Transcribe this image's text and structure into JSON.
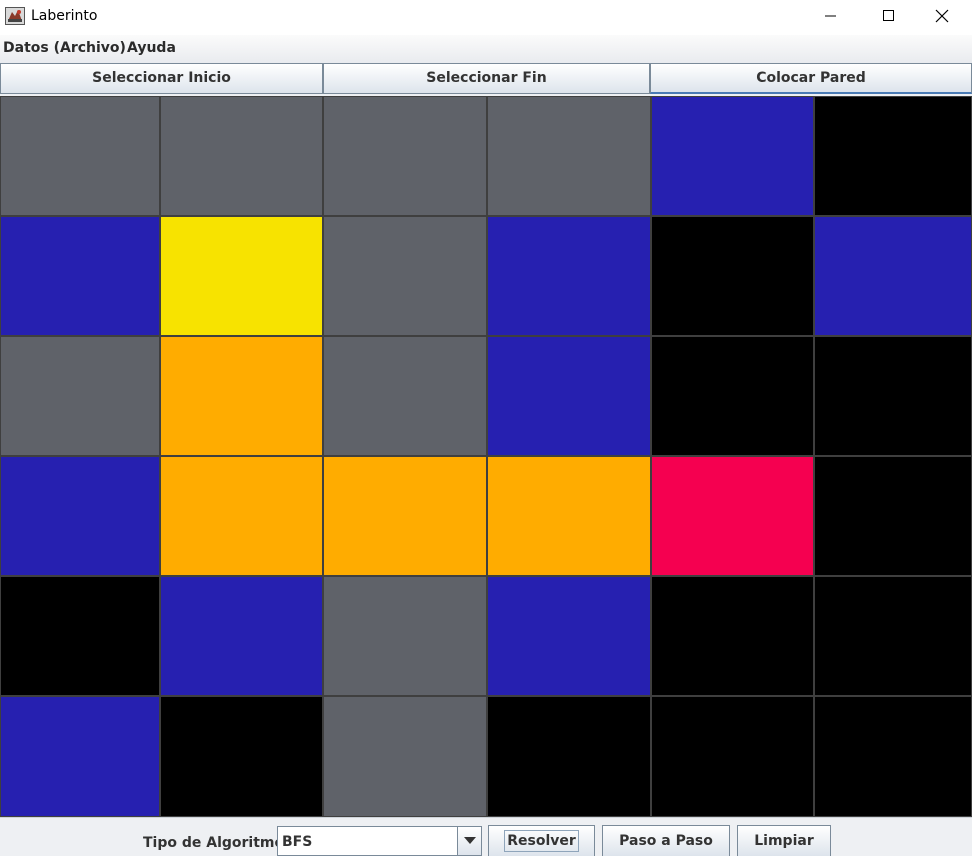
{
  "window": {
    "title": "Laberinto",
    "icons": {
      "app": "maze-app-icon",
      "minimize": "minimize-icon",
      "maximize": "maximize-icon",
      "close": "close-icon"
    }
  },
  "menu": {
    "items": [
      {
        "label": "Datos (Archivo)"
      },
      {
        "label": "Ayuda"
      }
    ]
  },
  "toolbar": {
    "buttons": [
      {
        "label": "Seleccionar Inicio"
      },
      {
        "label": "Seleccionar Fin"
      },
      {
        "label": "Colocar Pared"
      }
    ],
    "selected": "Colocar Pared"
  },
  "colors": {
    "empty": "#5f6269",
    "visited": "#2620b0",
    "wall": "#000000",
    "start": "#f7e300",
    "path": "#ffac00",
    "end": "#f50050"
  },
  "grid": {
    "rows": [
      [
        "empty",
        "empty",
        "empty",
        "empty",
        "visited",
        "wall"
      ],
      [
        "visited",
        "start",
        "empty",
        "visited",
        "wall",
        "visited"
      ],
      [
        "empty",
        "path",
        "empty",
        "visited",
        "wall",
        "wall"
      ],
      [
        "visited",
        "path",
        "path",
        "path",
        "end",
        "wall"
      ],
      [
        "wall",
        "visited",
        "empty",
        "visited",
        "wall",
        "wall"
      ],
      [
        "visited",
        "wall",
        "empty",
        "wall",
        "wall",
        "wall"
      ]
    ]
  },
  "controls": {
    "algorithm_label": "Tipo de Algoritmo:",
    "algorithm_value": "BFS",
    "solve_label": "Resolver",
    "step_label": "Paso a Paso",
    "clear_label": "Limpiar"
  }
}
